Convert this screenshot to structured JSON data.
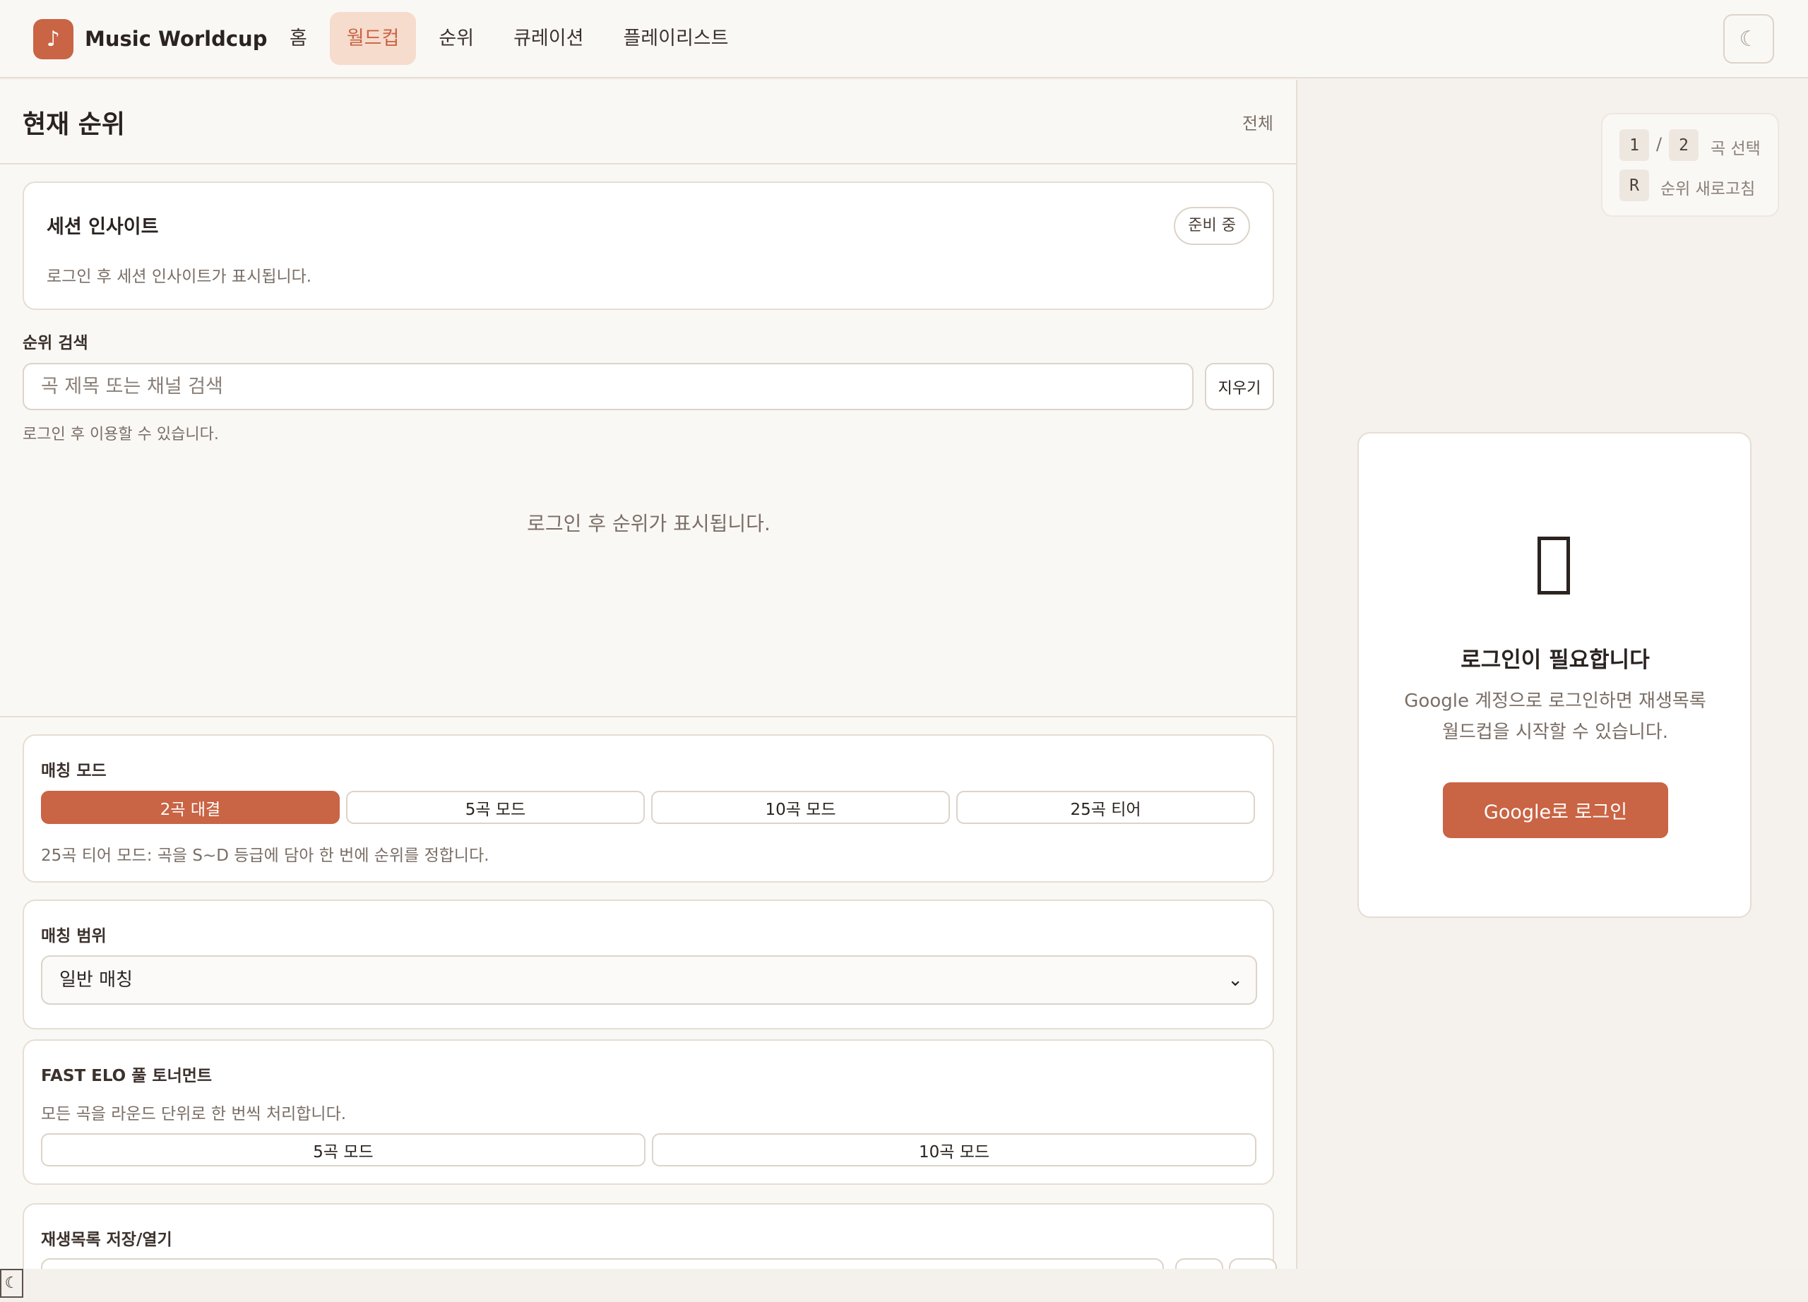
{
  "header": {
    "brand": "Music Worldcup",
    "logo_icon": "♪",
    "nav": [
      {
        "label": "홈",
        "active": false
      },
      {
        "label": "월드컵",
        "active": true
      },
      {
        "label": "순위",
        "active": false
      },
      {
        "label": "큐레이션",
        "active": false
      },
      {
        "label": "플레이리스트",
        "active": false
      }
    ],
    "theme_icon": "☾"
  },
  "ranking": {
    "title": "현재 순위",
    "all_link": "전체",
    "insight": {
      "title": "세션 인사이트",
      "badge": "준비 중",
      "desc": "로그인 후 세션 인사이트가 표시됩니다."
    },
    "search": {
      "label": "순위 검색",
      "placeholder": "곡 제목 또는 채널 검색",
      "clear": "지우기",
      "hint": "로그인 후 이용할 수 있습니다."
    },
    "empty": "로그인 후 순위가 표시됩니다."
  },
  "matching_mode": {
    "title": "매칭 모드",
    "buttons": [
      {
        "label": "2곡 대결",
        "active": true
      },
      {
        "label": "5곡 모드",
        "active": false
      },
      {
        "label": "10곡 모드",
        "active": false
      },
      {
        "label": "25곡 티어",
        "active": false
      }
    ],
    "desc": "25곡 티어 모드: 곡을 S~D 등급에 담아 한 번에 순위를 정합니다."
  },
  "matching_range": {
    "title": "매칭 범위",
    "selected": "일반 매칭"
  },
  "fast_elo": {
    "title": "FAST ELO 풀 토너먼트",
    "desc": "모든 곡을 라운드 단위로 한 번씩 처리합니다.",
    "buttons": [
      "5곡 모드",
      "10곡 모드"
    ]
  },
  "playlist_save": {
    "title": "재생목록 저장/열기"
  },
  "shortcuts": {
    "key1": "1",
    "key2": "2",
    "slash": "/",
    "pick": "곡 선택",
    "key_r": "R",
    "refresh": "순위 새로고침"
  },
  "login": {
    "title": "로그인이 필요합니다",
    "desc": "Google 계정으로 로그인하면 재생목록 월드컵을 시작할 수 있습니다.",
    "button": "Google로 로그인"
  },
  "corner_toggle": "☾",
  "colors": {
    "accent": "#c96444",
    "accent_soft": "#f6dccd",
    "background": "#f5f1ec",
    "border": "#e6ddd3"
  }
}
